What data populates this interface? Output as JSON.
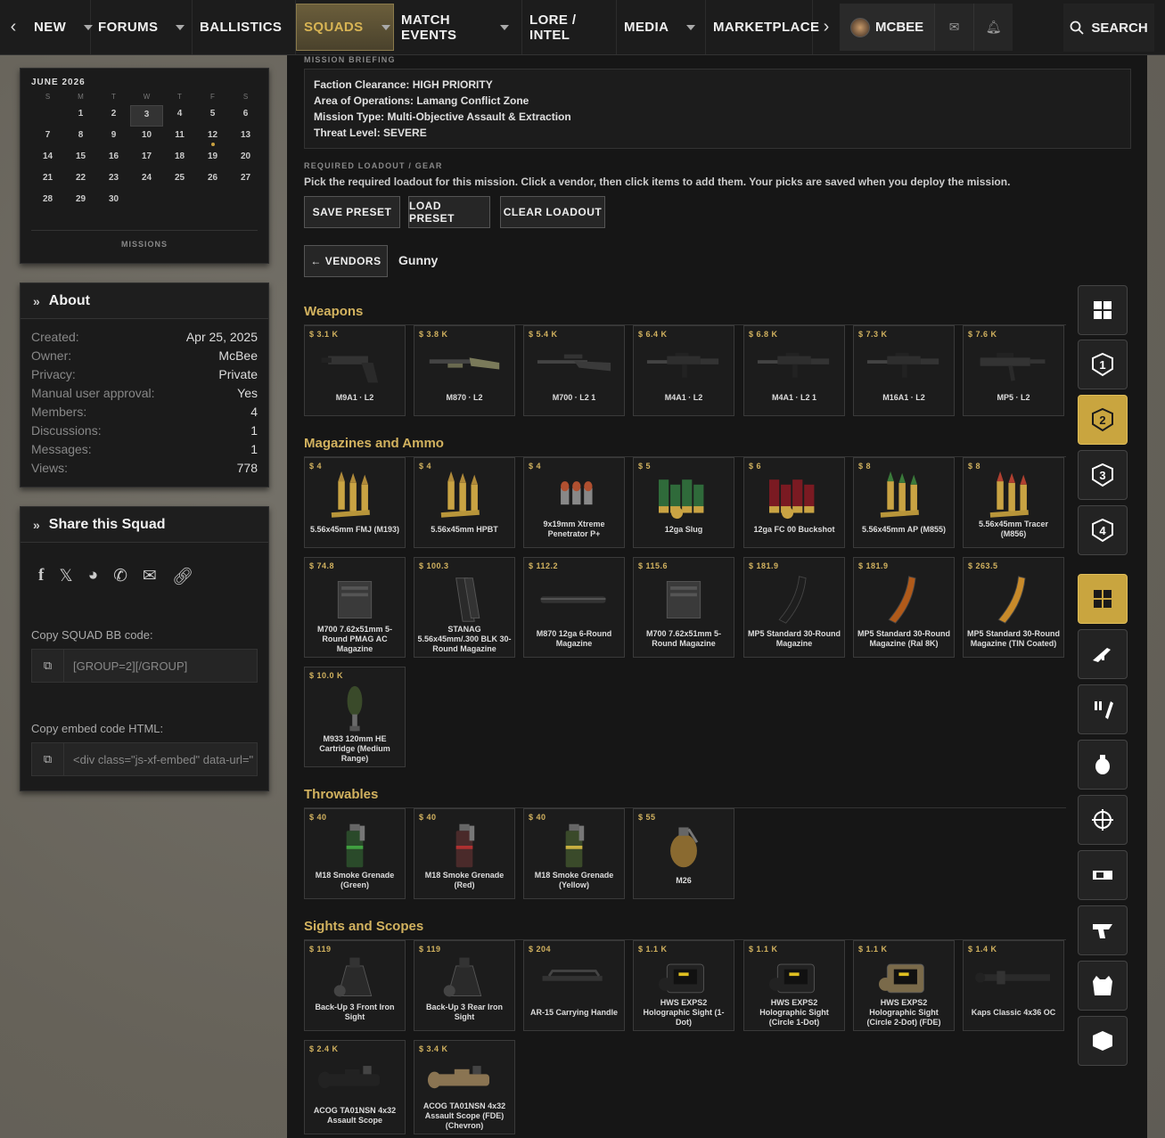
{
  "nav": {
    "items": [
      {
        "label": "NEW",
        "caret": true
      },
      {
        "label": "FORUMS",
        "caret": true
      },
      {
        "label": "BALLISTICS",
        "caret": true
      },
      {
        "label": "SQUADS",
        "caret": true,
        "active": true
      },
      {
        "label": "MATCH EVENTS",
        "caret": true
      },
      {
        "label": "LORE / INTEL",
        "caret": false
      },
      {
        "label": "MEDIA",
        "caret": true
      },
      {
        "label": "MARKETPLACE",
        "caret": false
      }
    ],
    "user": "MCBEE",
    "search": "SEARCH"
  },
  "calendar": {
    "title": "JUNE 2026",
    "dow": [
      "S",
      "M",
      "T",
      "W",
      "T",
      "F",
      "S"
    ],
    "days": [
      "",
      "1",
      "2",
      "3",
      "4",
      "5",
      "6",
      "7",
      "8",
      "9",
      "10",
      "11",
      "12",
      "13",
      "14",
      "15",
      "16",
      "17",
      "18",
      "19",
      "20",
      "21",
      "22",
      "23",
      "24",
      "25",
      "26",
      "27",
      "28",
      "29",
      "30"
    ],
    "today": "3",
    "event_day": "12",
    "footer": "MISSIONS"
  },
  "about": {
    "title": "About",
    "rows": [
      {
        "k": "Created:",
        "v": "Apr 25, 2025"
      },
      {
        "k": "Owner:",
        "v": "McBee"
      },
      {
        "k": "Privacy:",
        "v": "Private"
      },
      {
        "k": "Manual user approval:",
        "v": "Yes"
      },
      {
        "k": "Members:",
        "v": "4"
      },
      {
        "k": "Discussions:",
        "v": "1"
      },
      {
        "k": "Messages:",
        "v": "1"
      },
      {
        "k": "Views:",
        "v": "778"
      }
    ]
  },
  "share": {
    "title": "Share this Squad",
    "icons": [
      "facebook-icon",
      "x-icon",
      "reddit-icon",
      "whatsapp-icon",
      "email-icon",
      "link-icon"
    ],
    "bb_label": "Copy SQUAD BB code:",
    "bb_value": "[GROUP=2][/GROUP]",
    "embed_label": "Copy embed code HTML:",
    "embed_value": "<div class=\"js-xf-embed\" data-url=\""
  },
  "mission": {
    "briefing_label": "MISSION BRIEFING",
    "briefing": [
      "Faction Clearance: HIGH PRIORITY",
      "Area of Operations: Lamang Conflict Zone",
      "Mission Type: Multi-Objective Assault & Extraction",
      "Threat Level: SEVERE"
    ],
    "gear_label": "REQUIRED LOADOUT / GEAR",
    "gear_desc": "Pick the required loadout for this mission. Click a vendor, then click items to add them. Your picks are saved when you deploy the mission.",
    "buttons": {
      "save": "SAVE PRESET",
      "load": "LOAD PRESET",
      "clear": "CLEAR LOADOUT",
      "vendors": "← VENDORS"
    },
    "vendor": "Gunny"
  },
  "sections": [
    {
      "title": "Weapons",
      "items": [
        {
          "price": "$ 3.1 K",
          "name": "M9A1 · L2",
          "art": "pistol"
        },
        {
          "price": "$ 3.8 K",
          "name": "M870 · L2",
          "art": "shotgun"
        },
        {
          "price": "$ 5.4 K",
          "name": "M700 · L2 1",
          "art": "rifle"
        },
        {
          "price": "$ 6.4 K",
          "name": "M4A1 · L2",
          "art": "ar"
        },
        {
          "price": "$ 6.8 K",
          "name": "M4A1 · L2 1",
          "art": "ar"
        },
        {
          "price": "$ 7.3 K",
          "name": "M16A1 · L2",
          "art": "ar"
        },
        {
          "price": "$ 7.6 K",
          "name": "MP5 · L2",
          "art": "smg"
        }
      ]
    },
    {
      "title": "Magazines and Ammo",
      "items": [
        {
          "price": "$ 4",
          "name": "5.56x45mm FMJ (M193)",
          "art": "ammo"
        },
        {
          "price": "$ 4",
          "name": "5.56x45mm HPBT",
          "art": "ammo"
        },
        {
          "price": "$ 4",
          "name": "9x19mm Xtreme Penetrator P+",
          "art": "pammo"
        },
        {
          "price": "$ 5",
          "name": "12ga Slug",
          "art": "shell-g"
        },
        {
          "price": "$ 6",
          "name": "12ga FC 00 Buckshot",
          "art": "shell-r"
        },
        {
          "price": "$ 8",
          "name": "5.56x45mm AP (M855)",
          "art": "ammo-g"
        },
        {
          "price": "$ 8",
          "name": "5.56x45mm Tracer (M856)",
          "art": "ammo-r"
        },
        {
          "price": "$ 74.8",
          "name": "M700 7.62x51mm 5-Round PMAG AC Magazine",
          "art": "boxmag"
        },
        {
          "price": "$ 100.3",
          "name": "STANAG 5.56x45mm/.300 BLK 30-Round Magazine",
          "art": "stanag"
        },
        {
          "price": "$ 112.2",
          "name": "M870 12ga 6-Round Magazine",
          "art": "tube"
        },
        {
          "price": "$ 115.6",
          "name": "M700 7.62x51mm 5-Round Magazine",
          "art": "boxmag"
        },
        {
          "price": "$ 181.9",
          "name": "MP5 Standard 30-Round Magazine",
          "art": "curve-b"
        },
        {
          "price": "$ 181.9",
          "name": "MP5 Standard 30-Round Magazine (Ral 8K)",
          "art": "curve-o"
        },
        {
          "price": "$ 263.5",
          "name": "MP5 Standard 30-Round Magazine (TIN Coated)",
          "art": "curve-y"
        },
        {
          "price": "$ 10.0 K",
          "name": "M933 120mm HE Cartridge (Medium Range)",
          "art": "mortar"
        }
      ]
    },
    {
      "title": "Throwables",
      "items": [
        {
          "price": "$ 40",
          "name": "M18 Smoke Grenade (Green)",
          "art": "smoke-g"
        },
        {
          "price": "$ 40",
          "name": "M18 Smoke Grenade (Red)",
          "art": "smoke-r"
        },
        {
          "price": "$ 40",
          "name": "M18 Smoke Grenade (Yellow)",
          "art": "smoke-y"
        },
        {
          "price": "$ 55",
          "name": "M26",
          "art": "frag"
        }
      ]
    },
    {
      "title": "Sights and Scopes",
      "items": [
        {
          "price": "$ 119",
          "name": "Back-Up 3 Front Iron Sight",
          "art": "iron"
        },
        {
          "price": "$ 119",
          "name": "Back-Up 3 Rear Iron Sight",
          "art": "iron"
        },
        {
          "price": "$ 204",
          "name": "AR-15 Carrying Handle",
          "art": "handle"
        },
        {
          "price": "$ 1.1 K",
          "name": "HWS EXPS2 Holographic Sight (1-Dot)",
          "art": "holo"
        },
        {
          "price": "$ 1.1 K",
          "name": "HWS EXPS2 Holographic Sight (Circle 1-Dot)",
          "art": "holo"
        },
        {
          "price": "$ 1.1 K",
          "name": "HWS EXPS2 Holographic Sight (Circle 2-Dot) (FDE)",
          "art": "holo-fde"
        },
        {
          "price": "$ 1.4 K",
          "name": "Kaps Classic 4x36 OC",
          "art": "scope"
        },
        {
          "price": "$ 2.4 K",
          "name": "ACOG TA01NSN 4x32 Assault Scope",
          "art": "acog"
        },
        {
          "price": "$ 3.4 K",
          "name": "ACOG TA01NSN 4x32 Assault Scope (FDE) (Chevron)",
          "art": "acog-fde"
        }
      ]
    }
  ],
  "rail": [
    "grid-icon",
    "slot-1-icon",
    "slot-2-icon",
    "slot-3-icon",
    "slot-4-icon",
    "all-items-icon",
    "weapons-icon",
    "ammo-icon",
    "throwables-icon",
    "sights-icon",
    "attachments-icon",
    "grips-icon",
    "armor-icon",
    "gear-icon"
  ],
  "colors": {
    "accent": "#d2b25f",
    "active_rail": "#c9a53f"
  }
}
